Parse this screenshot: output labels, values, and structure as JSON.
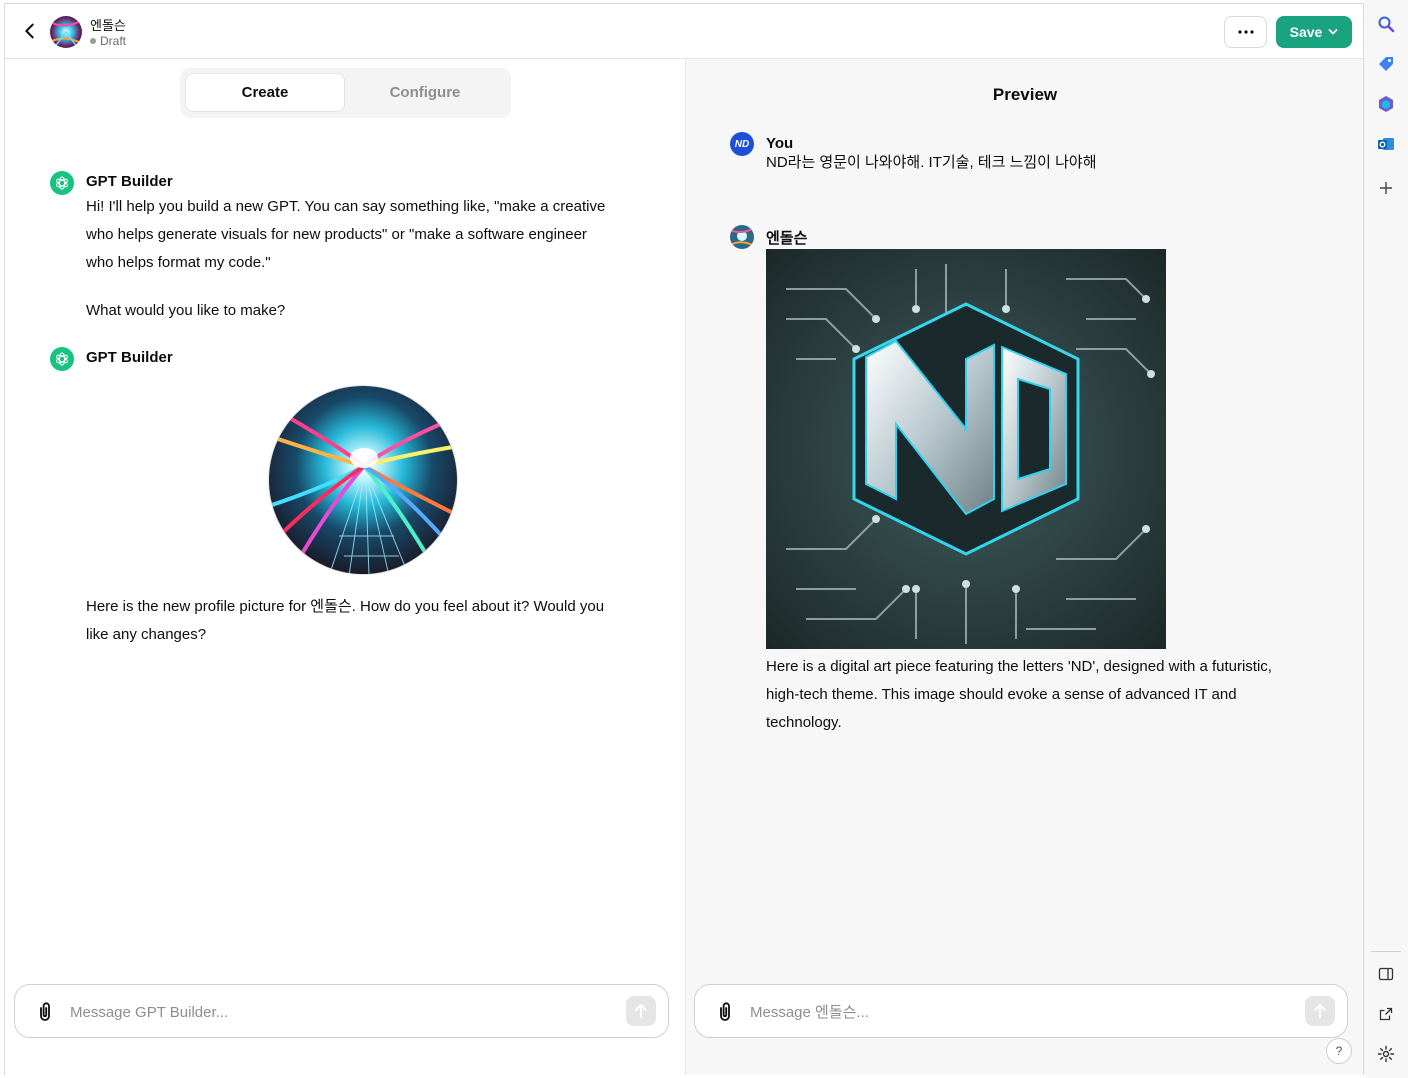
{
  "header": {
    "gpt_name": "엔돌슨",
    "status": "Draft",
    "more_label": "···",
    "save_label": "Save"
  },
  "tabs": [
    {
      "label": "Create",
      "active": true
    },
    {
      "label": "Configure",
      "active": false
    }
  ],
  "builder_chat": {
    "messages": [
      {
        "author": "GPT Builder",
        "paragraphs": [
          "Hi! I'll help you build a new GPT. You can say something like, \"make a creative",
          "who helps generate visuals for new products\" or \"make a software engineer",
          "who helps format my code.\"",
          "What would you like to make?"
        ]
      },
      {
        "author": "GPT Builder",
        "paragraphs": [
          "Here is the new profile picture for 엔돌슨. How do you feel about it? Would you",
          "like any changes?"
        ]
      }
    ],
    "composer_placeholder": "Message GPT Builder..."
  },
  "preview": {
    "title": "Preview",
    "user_message": {
      "avatar_text": "ND",
      "author": "You",
      "text": "ND라는 영문이 나와야해. IT기술, 테크 느낌이 나야해"
    },
    "gpt_message": {
      "author": "엔돌슨",
      "paragraphs": [
        "Here is a digital art piece featuring the letters 'ND', designed with a futuristic,",
        "high-tech theme. This image should evoke a sense of advanced IT and",
        "technology."
      ]
    },
    "composer_placeholder": "Message 엔돌슨...",
    "help_label": "?"
  },
  "colors": {
    "accent_green": "#19a37f",
    "builder_icon_green": "#19c37d",
    "user_avatar_blue": "#1e4fd8",
    "preview_bg": "#f7f7f7"
  },
  "rail_icons": [
    "search-icon",
    "tag-icon",
    "copilot-icon",
    "outlook-icon",
    "add-icon",
    "sidebar-icon",
    "external-link-icon",
    "settings-icon"
  ]
}
